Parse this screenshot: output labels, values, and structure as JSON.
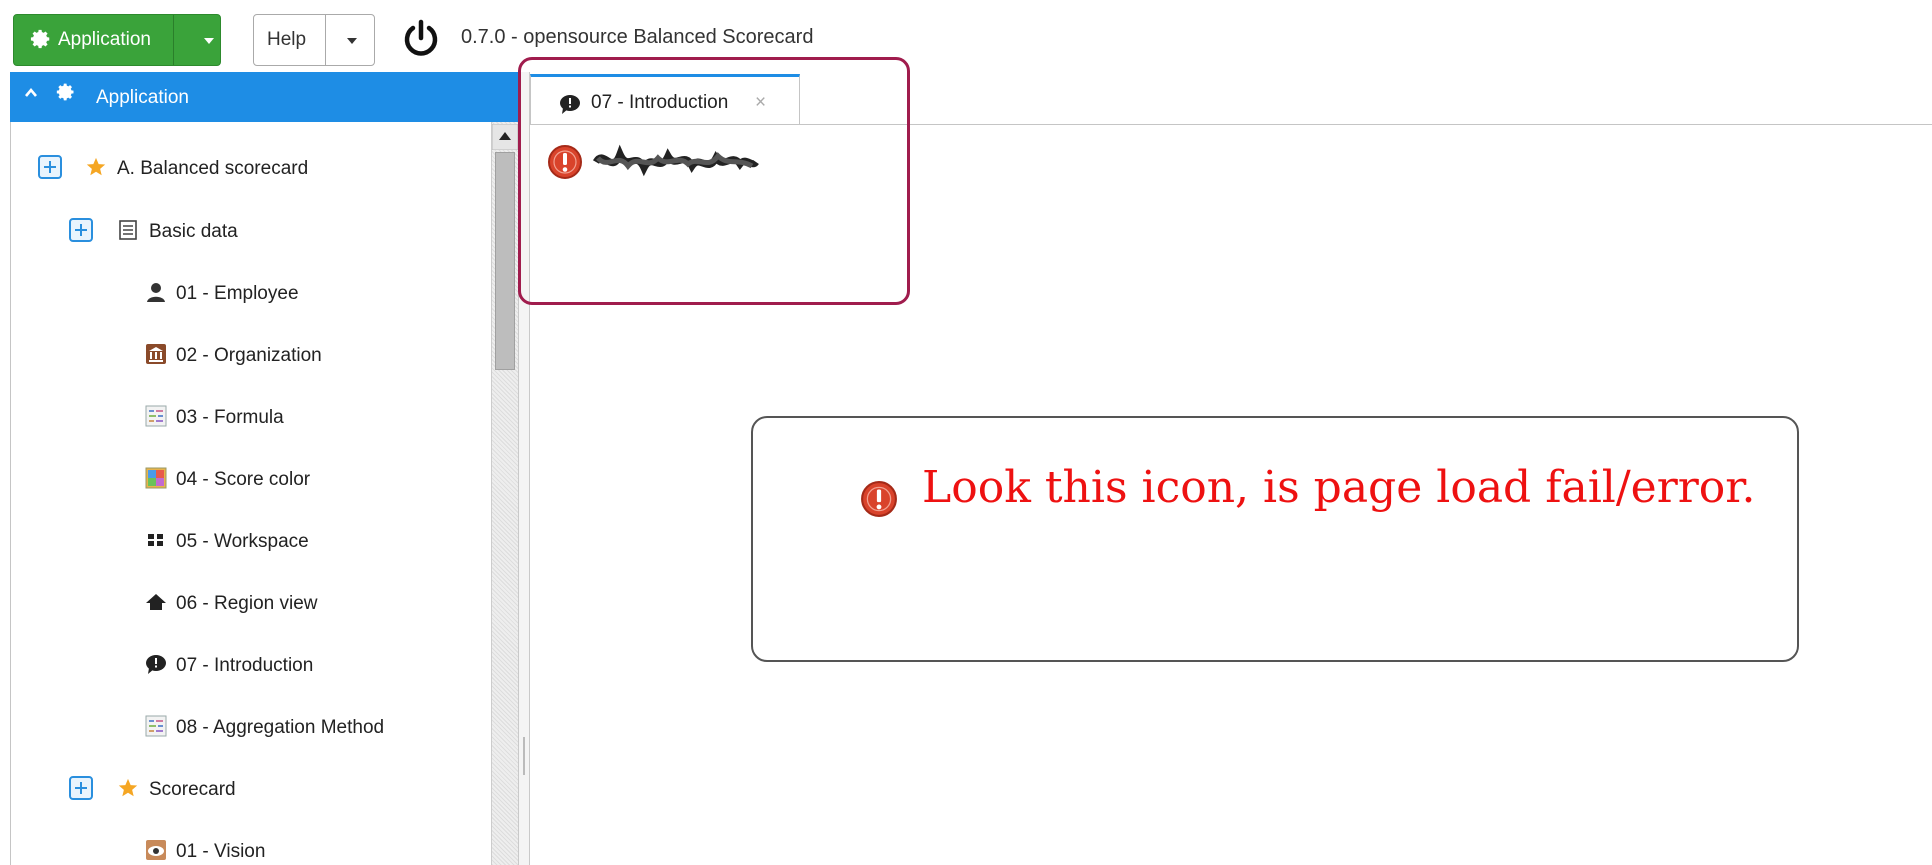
{
  "toolbar": {
    "app_button_label": "Application",
    "help_button_label": "Help",
    "version_text": "0.7.0 - opensource Balanced Scorecard"
  },
  "sidebar": {
    "header_label": "Application",
    "items": [
      {
        "label": "A. Balanced scorecard",
        "icon": "star-icon"
      },
      {
        "label": "Basic data",
        "icon": "document-icon"
      },
      {
        "label": "01 - Employee",
        "icon": "person-icon"
      },
      {
        "label": "02 - Organization",
        "icon": "building-icon"
      },
      {
        "label": "03 - Formula",
        "icon": "formula-icon"
      },
      {
        "label": "04 - Score color",
        "icon": "palette-icon"
      },
      {
        "label": "05 - Workspace",
        "icon": "grid-icon"
      },
      {
        "label": "06 - Region view",
        "icon": "home-icon"
      },
      {
        "label": "07 - Introduction",
        "icon": "speech-bubble-icon"
      },
      {
        "label": "08 - Aggregation Method",
        "icon": "formula-icon"
      },
      {
        "label": "Scorecard",
        "icon": "star-icon"
      },
      {
        "label": "01 - Vision",
        "icon": "eye-icon"
      }
    ]
  },
  "tabs": [
    {
      "label": "07 - Introduction",
      "close": "×",
      "active": true
    }
  ],
  "annotation": {
    "text": "Look this icon, is page load fail/error."
  },
  "colors": {
    "accent_blue": "#1e8de5",
    "app_green": "#3aa33a",
    "error_red": "#d9432b",
    "annotation_red": "#ee1111",
    "annotation_box": "#a01c4d",
    "star_orange": "#f5a623"
  }
}
